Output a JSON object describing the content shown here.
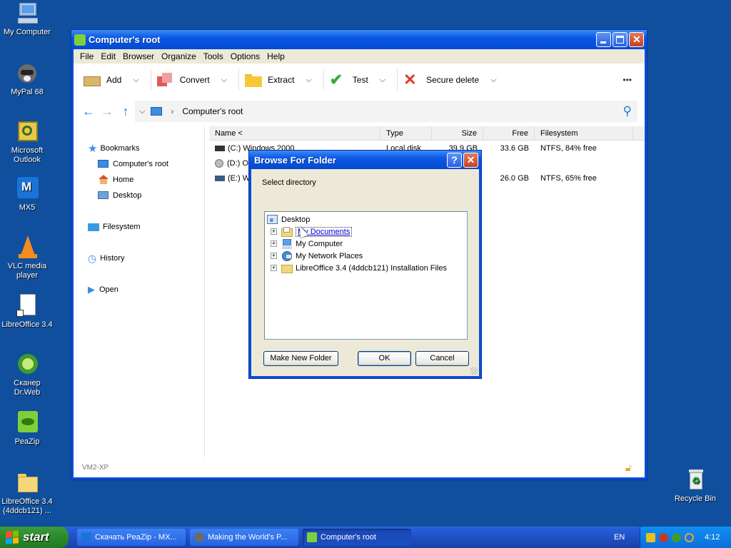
{
  "desktop": {
    "icons": [
      {
        "label": "My Computer",
        "icon": "my-computer-icon"
      },
      {
        "label": "MyPal 68",
        "icon": "mypal-icon"
      },
      {
        "label": "Microsoft Outlook",
        "icon": "outlook-icon"
      },
      {
        "label": "MX5",
        "icon": "mx5-icon"
      },
      {
        "label": "VLC media player",
        "icon": "vlc-icon"
      },
      {
        "label": "LibreOffice 3.4",
        "icon": "libreoffice-icon"
      },
      {
        "label": "Сканер Dr.Web",
        "icon": "drweb-icon"
      },
      {
        "label": "PeaZip",
        "icon": "peazip-icon"
      },
      {
        "label": "LibreOffice 3.4 (4ddcb121) ...",
        "icon": "folder-icon"
      },
      {
        "label": "Recycle Bin",
        "icon": "recycle-bin-icon"
      }
    ]
  },
  "window": {
    "title": "Computer's root",
    "menu": [
      "File",
      "Edit",
      "Browser",
      "Organize",
      "Tools",
      "Options",
      "Help"
    ],
    "toolbar": {
      "add": "Add",
      "convert": "Convert",
      "extract": "Extract",
      "test": "Test",
      "secure_delete": "Secure delete",
      "more": "•••"
    },
    "address": {
      "path": "Computer's root"
    },
    "sidebar": {
      "bookmarks": "Bookmarks",
      "computers_root": "Computer's root",
      "home": "Home",
      "desktop": "Desktop",
      "filesystem": "Filesystem",
      "history": "History",
      "open": "Open"
    },
    "columns": [
      "Name <",
      "Type",
      "Size",
      "Free",
      "Filesystem"
    ],
    "rows": [
      {
        "name": "(C:) Windows 2000",
        "type": "Local disk",
        "size": "39.9 GB",
        "free": "33.6 GB",
        "fs": "NTFS, 84% free"
      },
      {
        "name": "(D:) Optical",
        "type": "",
        "size": "",
        "free": "",
        "fs": ""
      },
      {
        "name": "(E:) W",
        "type": "",
        "size": "",
        "free": "26.0 GB",
        "fs": "NTFS, 65% free"
      }
    ],
    "status": "VM2-XP"
  },
  "dialog": {
    "title": "Browse For Folder",
    "help_btn": "?",
    "close_btn": "✕",
    "description": "Select directory",
    "tree": [
      {
        "label": "Desktop"
      },
      {
        "label": "My Documents"
      },
      {
        "label": "My Computer"
      },
      {
        "label": "My Network Places"
      },
      {
        "label": "LibreOffice 3.4 (4ddcb121) Installation Files"
      }
    ],
    "buttons": {
      "new_folder": "Make New Folder",
      "ok": "OK",
      "cancel": "Cancel"
    }
  },
  "taskbar": {
    "start": "start",
    "tasks": [
      {
        "label": "Скачать PeaZip - MX..."
      },
      {
        "label": "Making the World's P..."
      },
      {
        "label": "Computer's root"
      }
    ],
    "lang": "EN",
    "clock": "4:12"
  }
}
